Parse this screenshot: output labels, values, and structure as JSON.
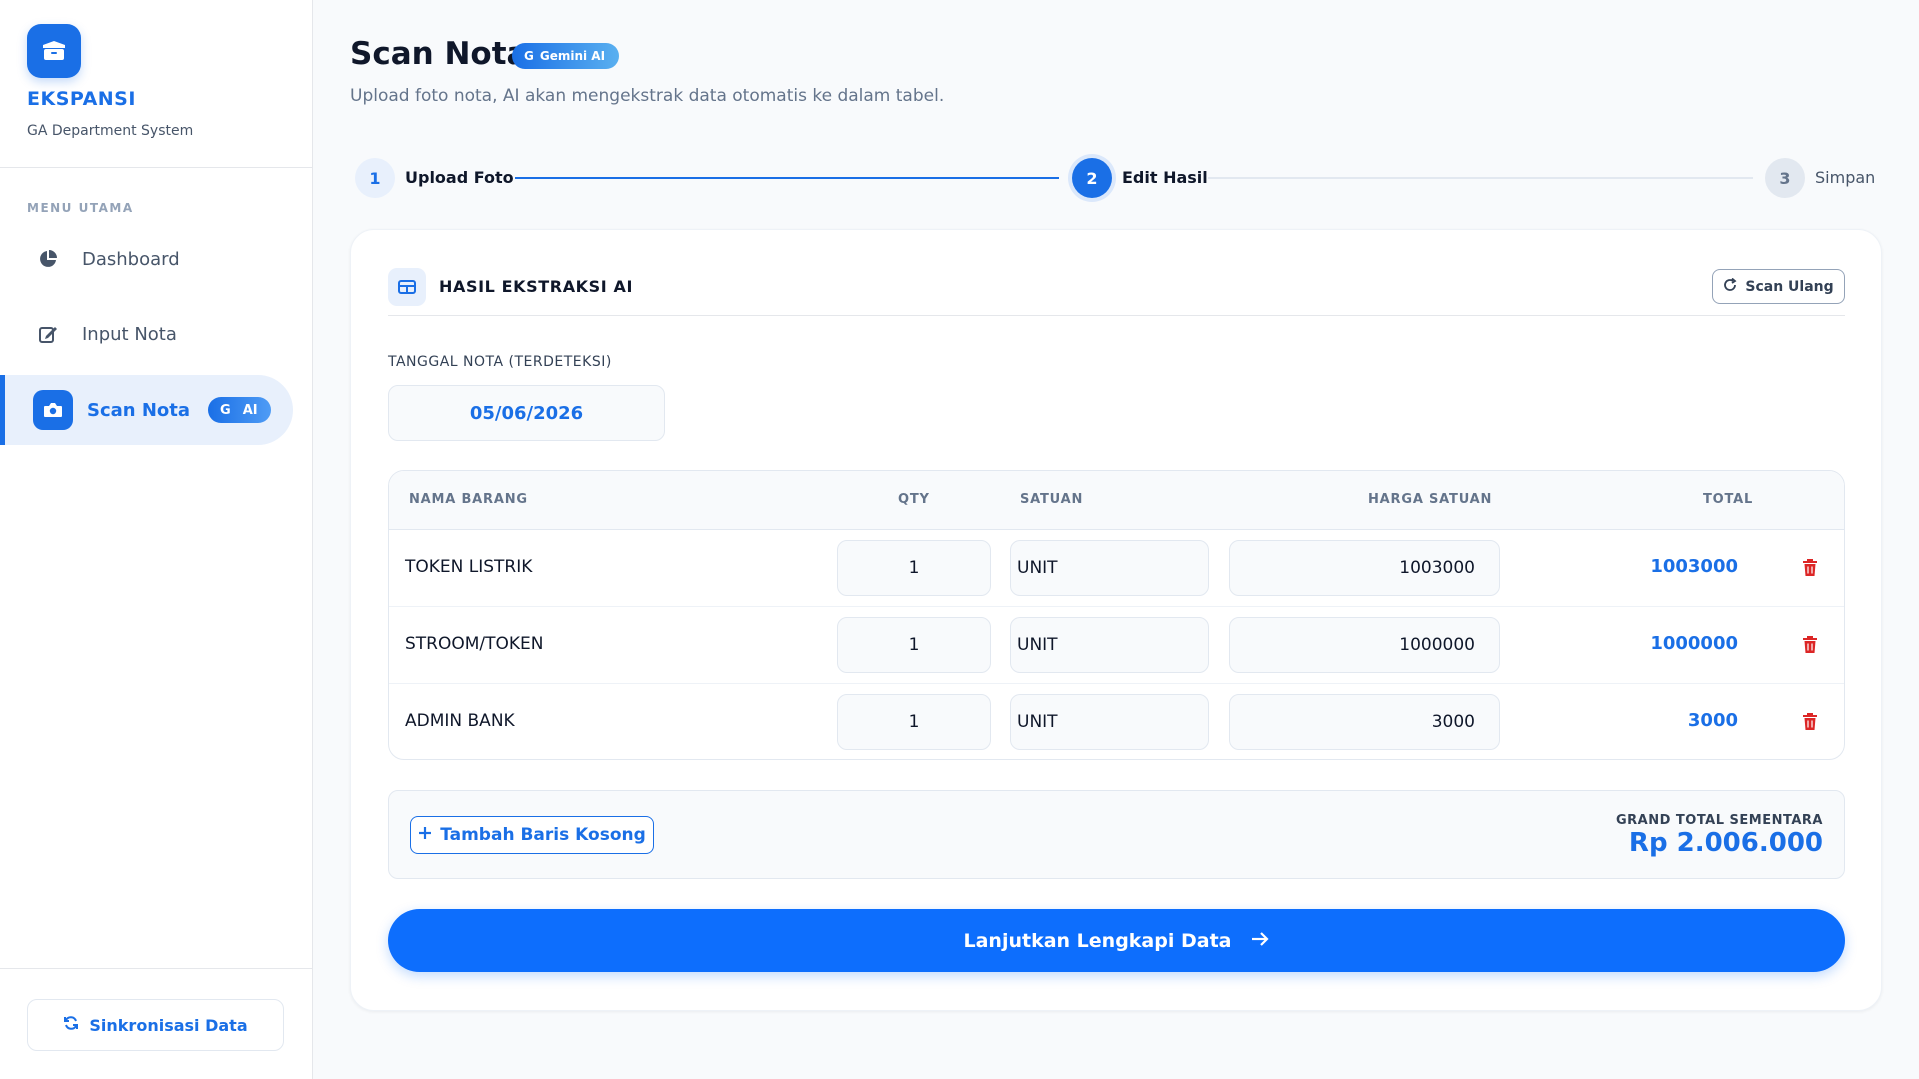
{
  "brand": {
    "name": "EKSPANSI",
    "subtitle": "GA Department System"
  },
  "sidebar": {
    "heading": "MENU UTAMA",
    "items": [
      {
        "label": "Dashboard",
        "icon": "pie-chart-icon"
      },
      {
        "label": "Input Nota",
        "icon": "edit-icon"
      },
      {
        "label": "Scan Nota",
        "icon": "camera-icon",
        "badge": "AI",
        "active": true
      }
    ],
    "sync_label": "Sinkronisasi Data"
  },
  "header": {
    "title": "Scan Nota",
    "badge": "Gemini AI",
    "subtitle": "Upload foto nota, AI akan mengekstrak data otomatis ke dalam tabel."
  },
  "stepper": {
    "steps": [
      {
        "number": "1",
        "label": "Upload Foto"
      },
      {
        "number": "2",
        "label": "Edit Hasil"
      },
      {
        "number": "3",
        "label": "Simpan"
      }
    ],
    "current": 2
  },
  "card": {
    "title": "HASIL EKSTRAKSI AI",
    "rescan_label": "Scan Ulang",
    "date_label": "TANGGAL NOTA (TERDETEKSI)",
    "date_value": "05/06/2026"
  },
  "table": {
    "headers": {
      "name": "NAMA BARANG",
      "qty": "QTY",
      "unit": "SATUAN",
      "price": "HARGA SATUAN",
      "total": "TOTAL"
    },
    "rows": [
      {
        "name": "TOKEN LISTRIK",
        "qty": "1",
        "unit": "UNIT",
        "price": "1003000",
        "total": "1003000"
      },
      {
        "name": "STROOM/TOKEN",
        "qty": "1",
        "unit": "UNIT",
        "price": "1000000",
        "total": "1000000"
      },
      {
        "name": "ADMIN BANK",
        "qty": "1",
        "unit": "UNIT",
        "price": "3000",
        "total": "3000"
      }
    ]
  },
  "footer": {
    "add_row_label": "Tambah Baris Kosong",
    "grand_total_label": "GRAND TOTAL SEMENTARA",
    "grand_total_value": "Rp 2.006.000",
    "cta_label": "Lanjutkan Lengkapi Data"
  },
  "colors": {
    "primary": "#1a6fe6",
    "cta": "#0d6efd",
    "danger": "#dc2626"
  }
}
